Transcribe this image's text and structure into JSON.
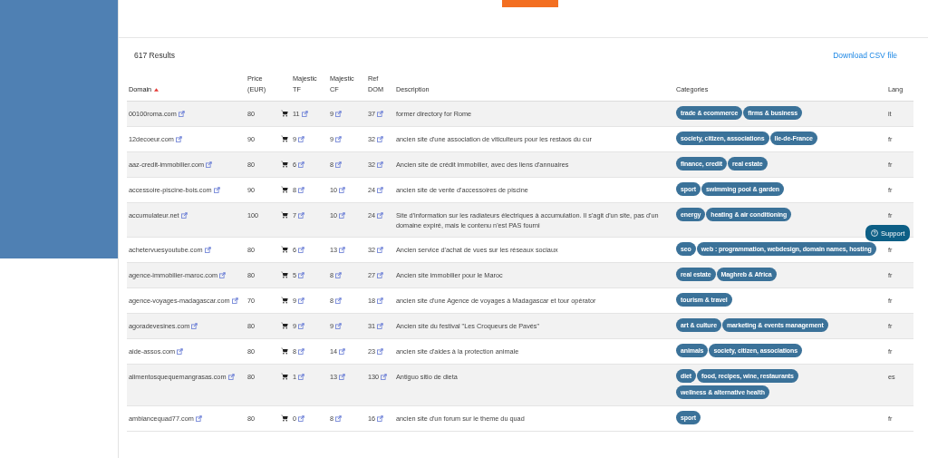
{
  "results_count": "617 Results",
  "download_link": "Download CSV file",
  "table": {
    "columns": [
      {
        "label": "Domain",
        "sorted": true
      },
      {
        "label": "Price (EUR)",
        "sorted": false
      },
      {
        "label": "Majestic TF",
        "sorted": false
      },
      {
        "label": "Majestic CF",
        "sorted": false
      },
      {
        "label": "Ref DOM",
        "sorted": false
      },
      {
        "label": "Description",
        "sorted": false
      },
      {
        "label": "Categories",
        "sorted": false
      },
      {
        "label": "Lang",
        "sorted": false
      }
    ],
    "rows": [
      {
        "domain": "00100roma.com",
        "price": "80",
        "tf": "11",
        "cf": "9",
        "ref_dom": "37",
        "description": "former directory for Rome",
        "categories": [
          "trade & ecommerce",
          "firms & business"
        ],
        "lang": "it"
      },
      {
        "domain": "12decoeur.com",
        "price": "90",
        "tf": "9",
        "cf": "9",
        "ref_dom": "32",
        "description": "ancien site d'une association de viticulteurs pour les restaos du cur",
        "categories": [
          "society, citizen, associations",
          "Ile-de-France"
        ],
        "lang": "fr"
      },
      {
        "domain": "aaz-credit-immobilier.com",
        "price": "80",
        "tf": "6",
        "cf": "8",
        "ref_dom": "32",
        "description": "Ancien site de crédit immobilier, avec des liens d'annuaires",
        "categories": [
          "finance, credit",
          "real estate"
        ],
        "lang": "fr"
      },
      {
        "domain": "accessoire-piscine-bois.com",
        "price": "90",
        "tf": "8",
        "cf": "10",
        "ref_dom": "24",
        "description": "ancien site de vente d'accessoires de piscine",
        "categories": [
          "sport",
          "swimming pool & garden"
        ],
        "lang": "fr"
      },
      {
        "domain": "accumulateur.net",
        "price": "100",
        "tf": "7",
        "cf": "10",
        "ref_dom": "24",
        "description": "Site d'information sur les radiateurs électriques à accumulation. Il s'agit d'un site, pas d'un domaine expiré, mais le contenu n'est PAS fourni",
        "categories": [
          "energy",
          "heating & air conditioning"
        ],
        "lang": "fr"
      },
      {
        "domain": "achetervuesyoutube.com",
        "price": "80",
        "tf": "6",
        "cf": "13",
        "ref_dom": "32",
        "description": "Ancien service d'achat de vues sur les réseaux sociaux",
        "categories": [
          "seo",
          "web : programmation, webdesign, domain names, hosting"
        ],
        "lang": "fr"
      },
      {
        "domain": "agence-immobilier-maroc.com",
        "price": "80",
        "tf": "5",
        "cf": "8",
        "ref_dom": "27",
        "description": "Ancien site immobilier pour le Maroc",
        "categories": [
          "real estate",
          "Maghreb & Africa"
        ],
        "lang": "fr"
      },
      {
        "domain": "agence-voyages-madagascar.com",
        "price": "70",
        "tf": "9",
        "cf": "8",
        "ref_dom": "18",
        "description": "ancien site d'une Agence de voyages à Madagascar et tour opérator",
        "categories": [
          "tourism & travel"
        ],
        "lang": "fr"
      },
      {
        "domain": "agoradevesines.com",
        "price": "80",
        "tf": "9",
        "cf": "9",
        "ref_dom": "31",
        "description": "Ancien site du festival \"Les Croqueurs de Pavés\"",
        "categories": [
          "art & culture",
          "marketing & events management"
        ],
        "lang": "fr"
      },
      {
        "domain": "aide-assos.com",
        "price": "80",
        "tf": "8",
        "cf": "14",
        "ref_dom": "23",
        "description": "ancien site d'aides à la protection animale",
        "categories": [
          "animals",
          "society, citizen, associations"
        ],
        "lang": "fr"
      },
      {
        "domain": "alimentosquequemangrasas.com",
        "price": "80",
        "tf": "1",
        "cf": "13",
        "ref_dom": "130",
        "description": "Antiguo sitio de dieta",
        "categories": [
          "diet",
          "food, recipes, wine, restaurants",
          "wellness & alternative health"
        ],
        "lang": "es"
      },
      {
        "domain": "ambiancequad77.com",
        "price": "80",
        "tf": "0",
        "cf": "8",
        "ref_dom": "16",
        "description": "ancien site d'un forum sur le theme du quad",
        "categories": [
          "sport"
        ],
        "lang": "fr"
      }
    ]
  },
  "support_button": "Support"
}
